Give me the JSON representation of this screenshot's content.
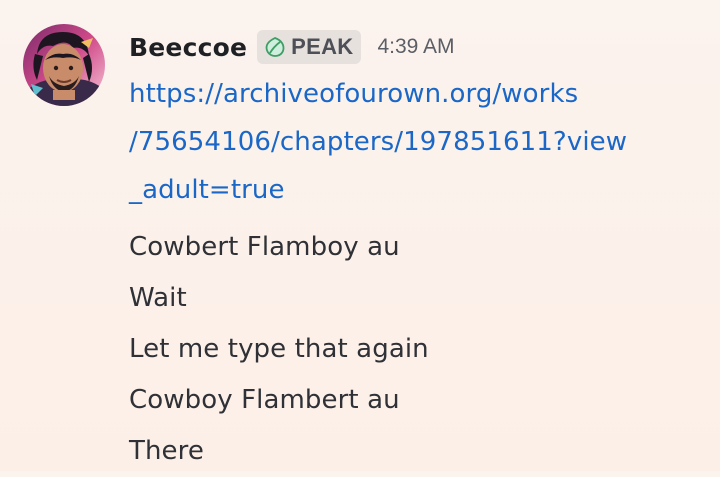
{
  "message": {
    "author": "Beeccoe",
    "tag": {
      "label": "PEAK",
      "icon": "leaf-icon",
      "color": "#5fbf7f"
    },
    "timestamp": "4:39 AM",
    "link_lines": [
      "https://archiveofourown.org/works",
      "/75654106/chapters/197851611?view",
      "_adult=true"
    ],
    "text_lines": [
      "Cowbert Flamboy au",
      "Wait",
      "Let me type that again",
      "Cowboy Flambert au",
      "There"
    ]
  },
  "colors": {
    "link": "#1a67c7",
    "text": "#2f3136",
    "background": "#fbf3ee"
  }
}
